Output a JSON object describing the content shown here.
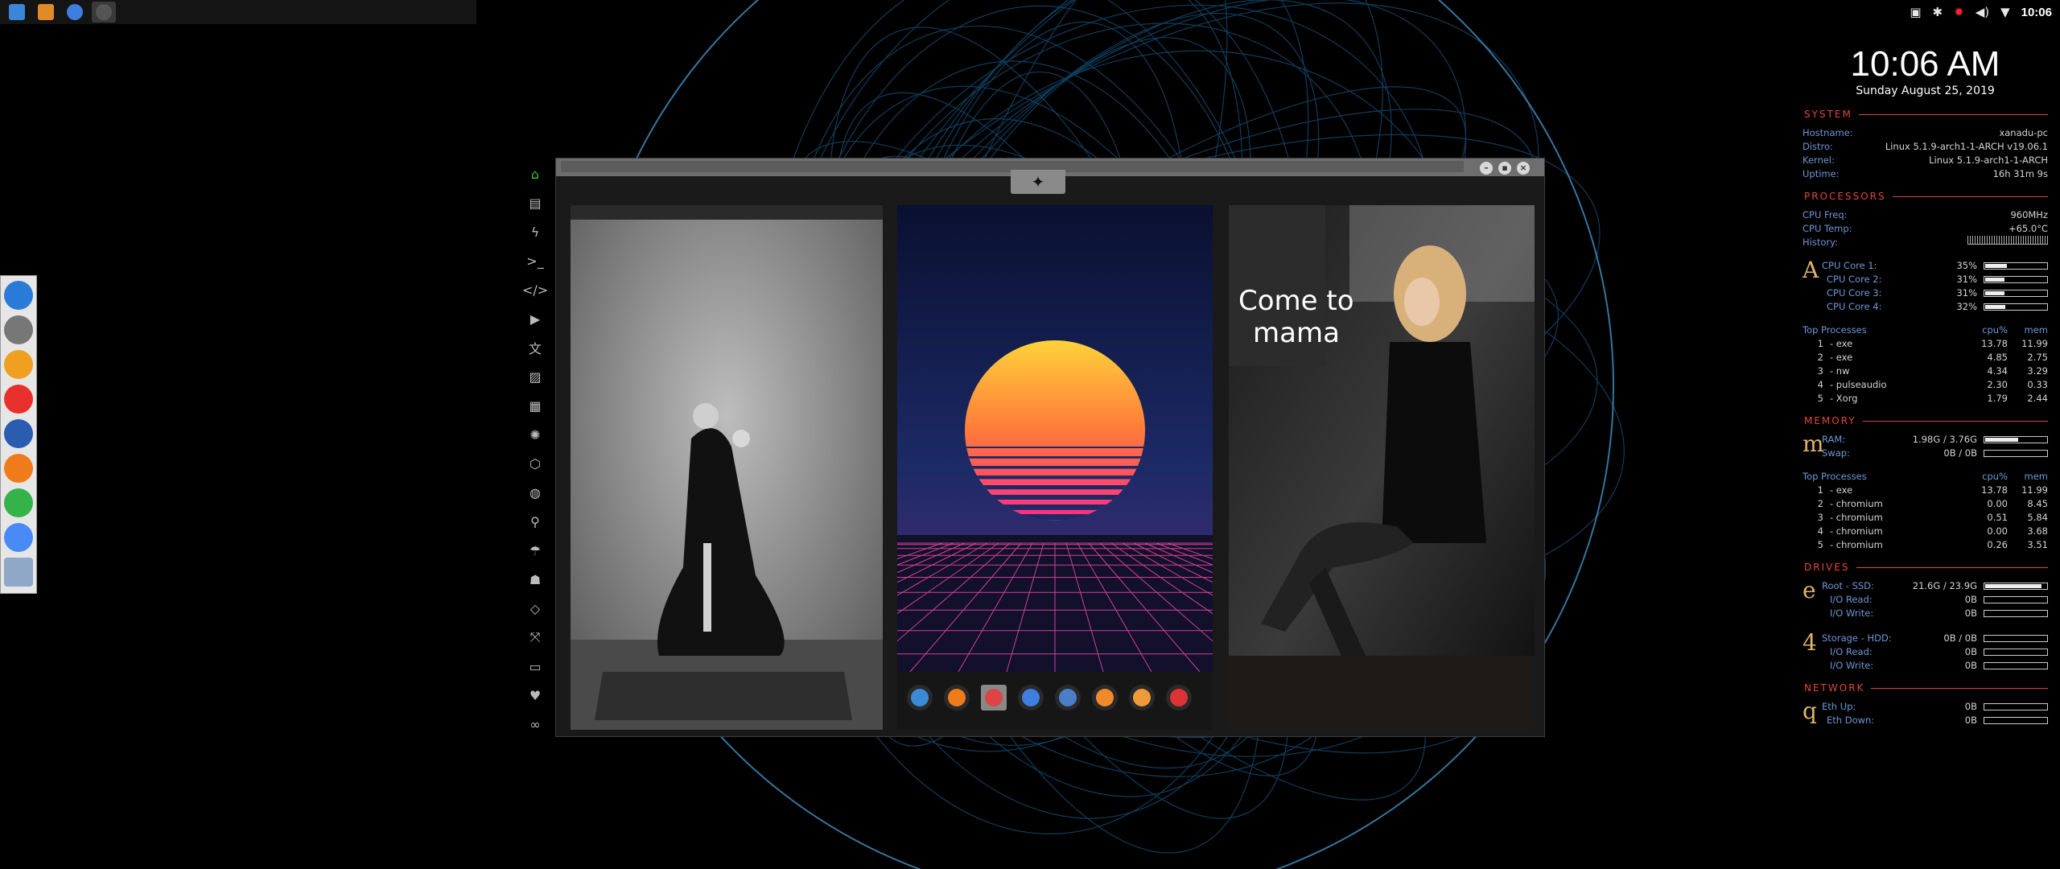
{
  "tray": {
    "time": "10:06"
  },
  "dock": {
    "items": [
      {
        "name": "files-icon",
        "color": "#2a7bd8"
      },
      {
        "name": "terminal-dollar-icon",
        "color": "#777777"
      },
      {
        "name": "settings-cog-icon",
        "color": "#f0a020"
      },
      {
        "name": "vivaldi-icon",
        "color": "#e8302c"
      },
      {
        "name": "screenshot-icon",
        "color": "#2a5cb0"
      },
      {
        "name": "sublime-s-icon",
        "color": "#f07b1a"
      },
      {
        "name": "system-monitor-icon",
        "color": "#36b24a"
      },
      {
        "name": "chromium-icon",
        "color": "#4a8af4"
      },
      {
        "name": "globe-grid-icon",
        "color": "#8fa8c8"
      }
    ]
  },
  "conky": {
    "clock": "10:06 AM",
    "date": "Sunday August 25, 2019",
    "system": {
      "title": "SYSTEM",
      "rows": [
        {
          "k": "Hostname:",
          "v": "xanadu-pc"
        },
        {
          "k": "Distro:",
          "v": "Linux 5.1.9-arch1-1-ARCH v19.06.1"
        },
        {
          "k": "Kernel:",
          "v": "Linux 5.1.9-arch1-1-ARCH"
        },
        {
          "k": "Uptime:",
          "v": "16h 31m 9s"
        }
      ]
    },
    "processors": {
      "title": "PROCESSORS",
      "freq_k": "CPU Freq:",
      "freq_v": "960MHz",
      "temp_k": "CPU Temp:",
      "temp_v": "+65.0°C",
      "hist_k": "History:",
      "letter": "A",
      "cores": [
        {
          "k": "CPU Core 1:",
          "v": "35%",
          "level": 0.35
        },
        {
          "k": "CPU Core 2:",
          "v": "31%",
          "level": 0.31
        },
        {
          "k": "CPU Core 3:",
          "v": "31%",
          "level": 0.31
        },
        {
          "k": "CPU Core 4:",
          "v": "32%",
          "level": 0.32
        }
      ],
      "top_head": {
        "n": "Top Processes",
        "c": "cpu%",
        "m": "mem"
      },
      "top": [
        {
          "i": "1",
          "n": "- exe",
          "c": "13.78",
          "m": "11.99"
        },
        {
          "i": "2",
          "n": "- exe",
          "c": "4.85",
          "m": "2.75"
        },
        {
          "i": "3",
          "n": "- nw",
          "c": "4.34",
          "m": "3.29"
        },
        {
          "i": "4",
          "n": "- pulseaudio",
          "c": "2.30",
          "m": "0.33"
        },
        {
          "i": "5",
          "n": "- Xorg",
          "c": "1.79",
          "m": "2.44"
        }
      ]
    },
    "memory": {
      "title": "MEMORY",
      "letter": "m",
      "ram_k": "RAM:",
      "ram_v": "1.98G / 3.76G",
      "ram_level": 0.53,
      "swap_k": "Swap:",
      "swap_v": "0B / 0B",
      "top_head": {
        "n": "Top Processes",
        "c": "cpu%",
        "m": "mem"
      },
      "top": [
        {
          "i": "1",
          "n": "- exe",
          "c": "13.78",
          "m": "11.99"
        },
        {
          "i": "2",
          "n": "- chromium",
          "c": "0.00",
          "m": "8.45"
        },
        {
          "i": "3",
          "n": "- chromium",
          "c": "0.51",
          "m": "5.84"
        },
        {
          "i": "4",
          "n": "- chromium",
          "c": "0.00",
          "m": "3.68"
        },
        {
          "i": "5",
          "n": "- chromium",
          "c": "0.26",
          "m": "3.51"
        }
      ]
    },
    "drives": {
      "title": "DRIVES",
      "root": {
        "letter": "e",
        "k": "Root  -  SSD:",
        "v": "21.6G / 23.9G",
        "level": 0.9,
        "read_k": "I/O Read:",
        "read_v": "0B",
        "write_k": "I/O Write:",
        "write_v": "0B"
      },
      "storage": {
        "letter": "4",
        "k": "Storage  -  HDD:",
        "v": "0B / 0B",
        "read_k": "I/O Read:",
        "read_v": "0B",
        "write_k": "I/O Write:",
        "write_v": "0B"
      }
    },
    "network": {
      "title": "NETWORK",
      "letter": "q",
      "up_k": "Eth Up:",
      "up_v": "0B",
      "down_k": "Eth Down:",
      "down_v": "0B"
    }
  },
  "window": {
    "overlay_text_line1": "Come to",
    "overlay_text_line2": "mama"
  }
}
